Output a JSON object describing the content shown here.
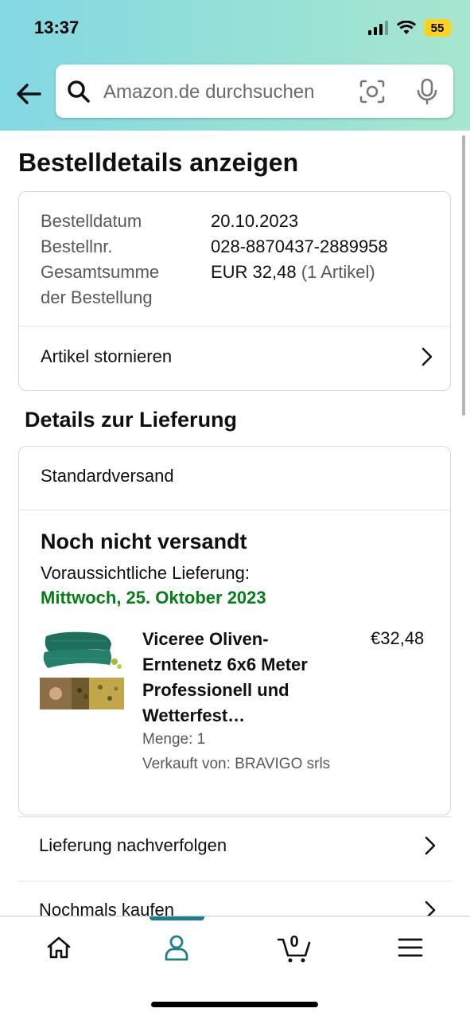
{
  "status_bar": {
    "time": "13:37",
    "battery": "55"
  },
  "search": {
    "placeholder": "Amazon.de durchsuchen"
  },
  "page_title": "Bestelldetails anzeigen",
  "order": {
    "date_label": "Bestelldatum",
    "date_value": "20.10.2023",
    "number_label": "Bestellnr.",
    "number_value": "028-8870437-2889958",
    "total_label_line1": "Gesamtsumme",
    "total_label_line2": "der Bestellung",
    "total_value": "EUR 32,48",
    "total_items": "(1 Artikel)",
    "cancel_label": "Artikel stornieren"
  },
  "delivery": {
    "section_title": "Details zur Lieferung",
    "shipping_method": "Standardversand",
    "status": "Noch nicht versandt",
    "eta_label": "Voraussichtliche Lieferung:",
    "eta_date": "Mittwoch, 25. Oktober 2023",
    "product": {
      "title": "Viceree Oliven-Erntenetz 6x6 Meter Professionell und Wetterfest…",
      "price": "€32,48",
      "quantity": "Menge: 1",
      "seller": "Verkauft von: BRAVIGO srls"
    }
  },
  "actions": {
    "track_label": "Lieferung nachverfolgen",
    "buy_again_label": "Nochmals kaufen"
  },
  "tabbar": {
    "cart_count": "0",
    "items": [
      "home-icon",
      "account-icon",
      "cart-icon",
      "menu-icon"
    ]
  },
  "colors": {
    "accent": "#1d7f8c",
    "delivery_green": "#067d19",
    "battery": "#ffd21f"
  }
}
